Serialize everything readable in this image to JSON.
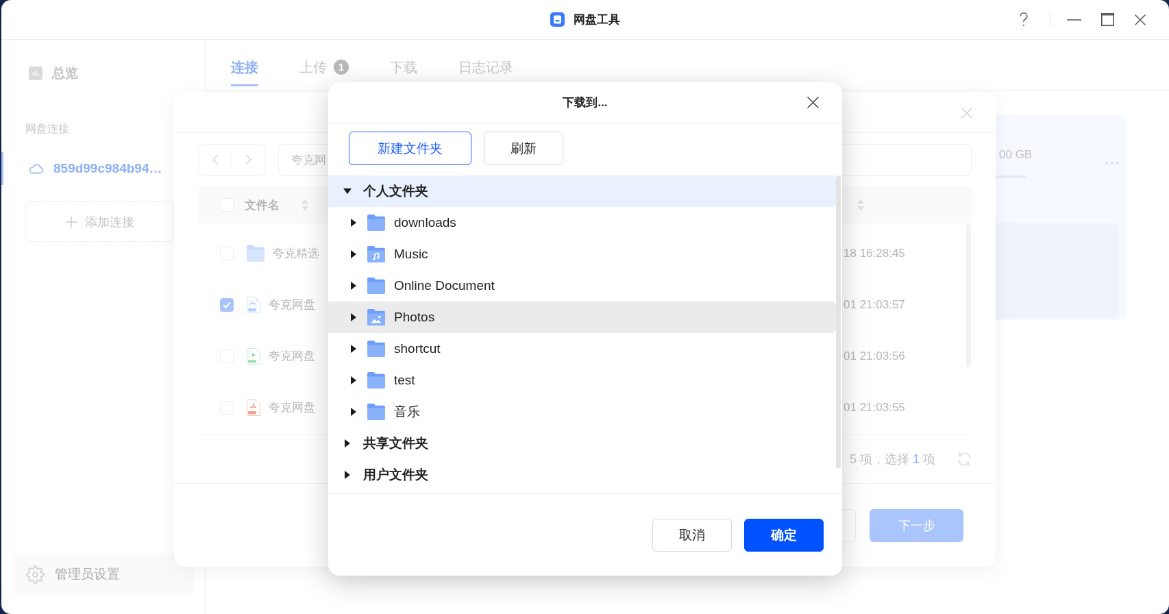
{
  "window": {
    "title": "网盘工具"
  },
  "sidebar": {
    "overview": {
      "label": "总览"
    },
    "section_title": "网盘连接",
    "connections": [
      {
        "name": "859d99c984b94…",
        "selected": true
      }
    ],
    "add_connection": {
      "label": "添加连接"
    },
    "admin_settings": {
      "label": "管理员设置"
    }
  },
  "tabs": [
    {
      "label": "连接",
      "selected": true
    },
    {
      "label": "上传",
      "selected": false,
      "badge": "1"
    },
    {
      "label": "下载",
      "selected": false
    },
    {
      "label": "日志记录",
      "selected": false
    }
  ],
  "storage_card": {
    "capacity": "00 GB"
  },
  "file_dialog": {
    "path": "夸克网",
    "select_all": {
      "checked": false
    },
    "columns": [
      "文件名"
    ],
    "rows": [
      {
        "kind": "folder",
        "name": "夸克精选",
        "checked": false,
        "modified": "18 16:28:45"
      },
      {
        "kind": "image",
        "name": "夸克网盘",
        "checked": true,
        "modified": "01 21:03:57"
      },
      {
        "kind": "video",
        "name": "夸克网盘",
        "checked": false,
        "modified": "01 21:03:56"
      },
      {
        "kind": "pdf",
        "name": "夸克网盘",
        "checked": false,
        "modified": "01 21:03:55"
      }
    ],
    "status": {
      "before": "5 项，选择",
      "count": "1",
      "after": "项"
    },
    "next_button": "下一步"
  },
  "download_dialog": {
    "title": "下载到...",
    "toolbar": [
      {
        "label": "新建文件夹",
        "kind": "outline"
      },
      {
        "label": "刷新",
        "kind": "default"
      }
    ],
    "tree": [
      {
        "label": "个人文件夹",
        "expanded": true,
        "selected": true,
        "hovered": false,
        "children": [
          {
            "label": "downloads",
            "kind": "folder",
            "expanded": false,
            "selected": false,
            "hovered": false
          },
          {
            "label": "Music",
            "kind": "music",
            "expanded": false,
            "selected": false,
            "hovered": false
          },
          {
            "label": "Online Document",
            "kind": "folder",
            "expanded": false,
            "selected": false,
            "hovered": false
          },
          {
            "label": "Photos",
            "kind": "photos",
            "expanded": false,
            "selected": false,
            "hovered": true
          },
          {
            "label": "shortcut",
            "kind": "folder",
            "expanded": false,
            "selected": false,
            "hovered": false
          },
          {
            "label": "test",
            "kind": "folder",
            "expanded": false,
            "selected": false,
            "hovered": false
          },
          {
            "label": "音乐",
            "kind": "folder",
            "expanded": false,
            "selected": false,
            "hovered": false
          }
        ]
      },
      {
        "label": "共享文件夹",
        "expanded": false,
        "selected": false,
        "hovered": false
      },
      {
        "label": "用户文件夹",
        "expanded": false,
        "selected": false,
        "hovered": false
      }
    ],
    "buttons": [
      {
        "label": "取消",
        "kind": "default"
      },
      {
        "label": "确定",
        "kind": "primary"
      }
    ]
  }
}
